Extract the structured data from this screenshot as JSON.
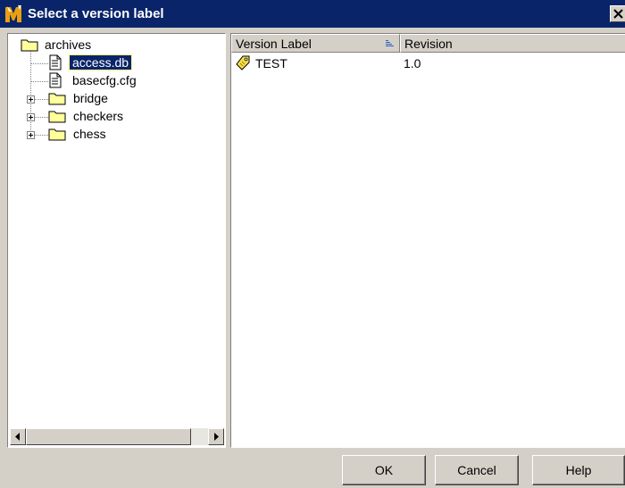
{
  "window": {
    "title": "Select a version label",
    "close_glyph": "✕"
  },
  "tree": {
    "items": [
      {
        "label": "archives",
        "icon": "folder-icon",
        "expanded": true
      },
      {
        "label": "access.db",
        "icon": "file-icon",
        "selected": true
      },
      {
        "label": "basecfg.cfg",
        "icon": "file-icon"
      },
      {
        "label": "bridge",
        "icon": "folder-icon",
        "expandable": true
      },
      {
        "label": "checkers",
        "icon": "folder-icon",
        "expandable": true
      },
      {
        "label": "chess",
        "icon": "folder-icon",
        "expandable": true
      }
    ]
  },
  "table": {
    "columns": [
      {
        "label": "Version Label",
        "sorted": "ascending"
      },
      {
        "label": "Revision"
      }
    ],
    "rows": [
      {
        "label": "TEST",
        "revision": "1.0",
        "icon": "tag-icon"
      }
    ]
  },
  "buttons": {
    "ok": "OK",
    "cancel": "Cancel",
    "help": "Help"
  },
  "colors": {
    "title_bar": "#0a246a",
    "face": "#d4d0c8",
    "selection": "#0a246a",
    "folder": "#ffff9c",
    "tag": "#f7e04a"
  }
}
